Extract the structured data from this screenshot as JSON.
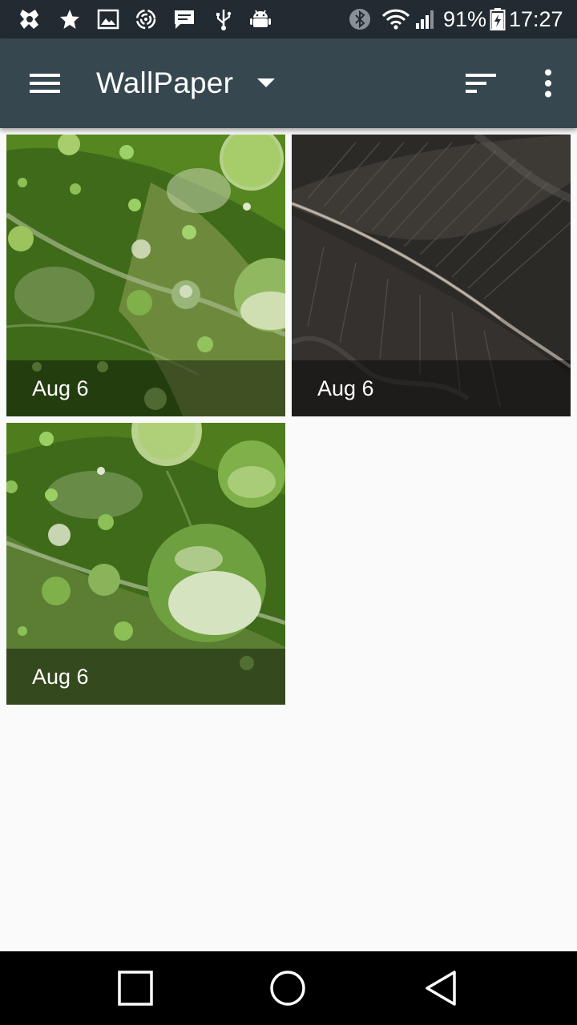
{
  "status_bar": {
    "battery_percent": "91%",
    "time": "17:27",
    "left_icons": [
      "app-logo-icon",
      "star-icon",
      "image-icon",
      "swirl-icon",
      "message-icon",
      "usb-icon",
      "android-icon"
    ],
    "right_icons": [
      "bluetooth-icon",
      "wifi-icon",
      "signal-icon",
      "battery-icon"
    ]
  },
  "app_bar": {
    "title": "WallPaper",
    "background": "#37474f"
  },
  "gallery": {
    "items": [
      {
        "caption": "Aug 6",
        "subject": "green leaf with water drops"
      },
      {
        "caption": "Aug 6",
        "subject": "dark feather close-up"
      },
      {
        "caption": "Aug 6",
        "subject": "green leaf with large water drop"
      }
    ]
  },
  "nav_bar": {
    "buttons": [
      "recents-button",
      "home-button",
      "back-button"
    ]
  }
}
